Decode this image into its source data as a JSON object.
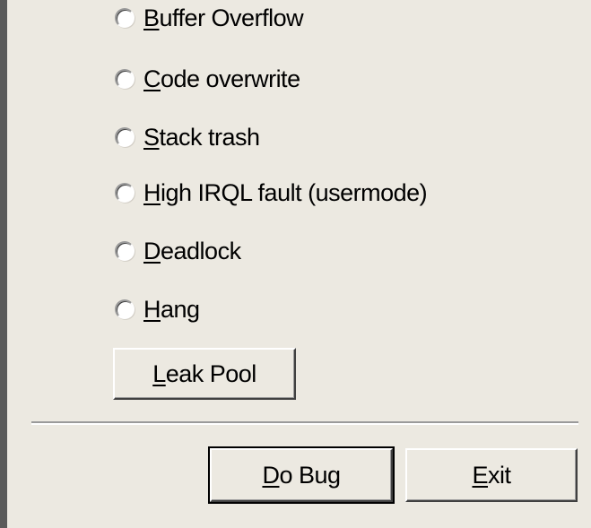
{
  "radio_options": [
    {
      "prefix": "",
      "mnemonic": "B",
      "rest": "uffer Overflow"
    },
    {
      "prefix": "",
      "mnemonic": "C",
      "rest": "ode overwrite"
    },
    {
      "prefix": "",
      "mnemonic": "S",
      "rest": "tack trash"
    },
    {
      "prefix": "",
      "mnemonic": "H",
      "rest": "igh IRQL fault (usermode)"
    },
    {
      "prefix": "",
      "mnemonic": "D",
      "rest": "eadlock"
    },
    {
      "prefix": "",
      "mnemonic": "H",
      "rest": "ang"
    }
  ],
  "leak_pool_button": {
    "mnemonic": "L",
    "rest": "eak Pool"
  },
  "do_bug_button": {
    "mnemonic": "D",
    "rest": "o Bug"
  },
  "exit_button": {
    "mnemonic": "E",
    "rest": "xit"
  }
}
